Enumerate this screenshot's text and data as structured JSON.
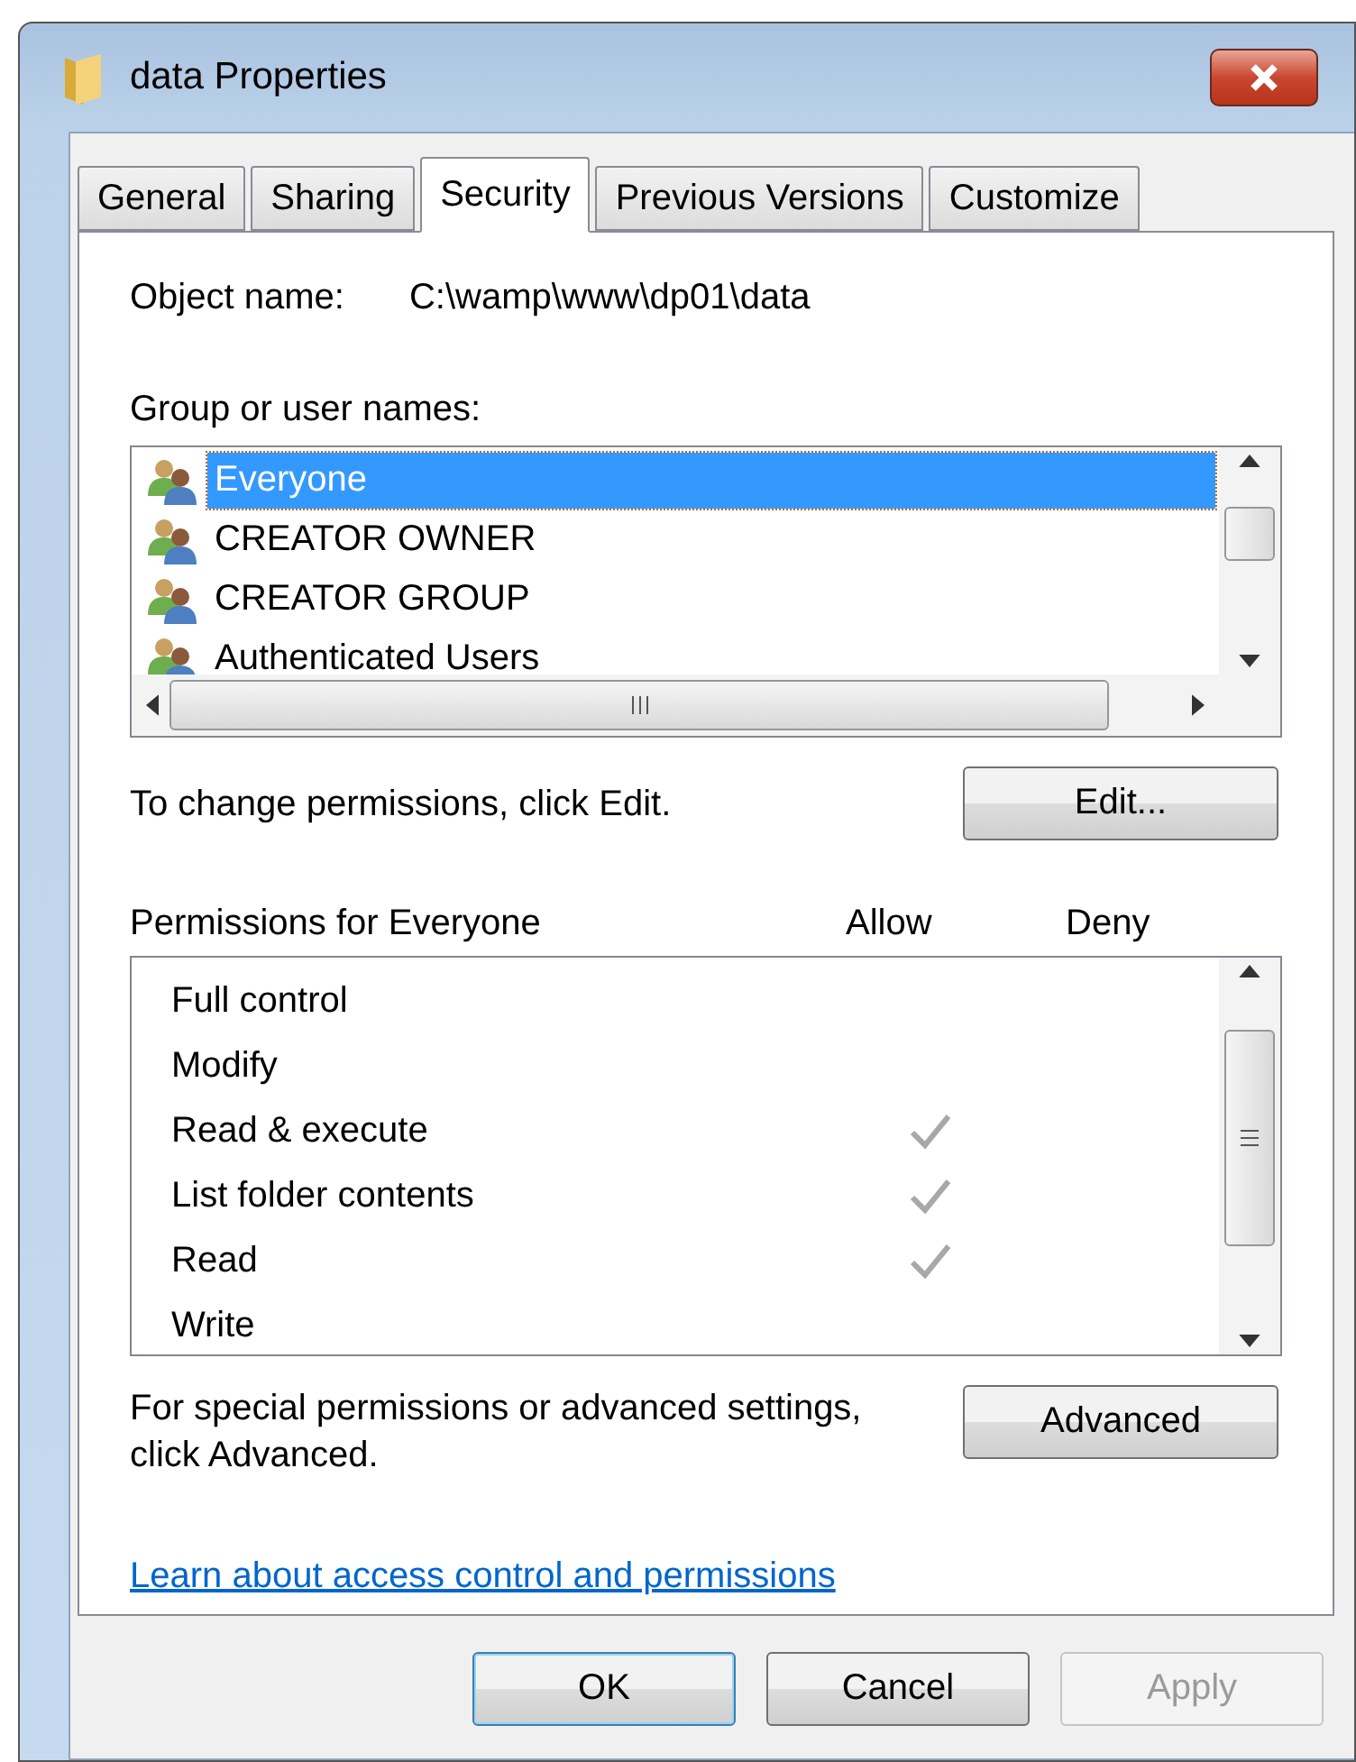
{
  "window": {
    "title": "data Properties"
  },
  "tabs": [
    {
      "label": "General",
      "selected": false
    },
    {
      "label": "Sharing",
      "selected": false
    },
    {
      "label": "Security",
      "selected": true
    },
    {
      "label": "Previous Versions",
      "selected": false
    },
    {
      "label": "Customize",
      "selected": false
    }
  ],
  "object_name": {
    "label": "Object name:",
    "value": "C:\\wamp\\www\\dp01\\data"
  },
  "groups": {
    "label": "Group or user names:",
    "items": [
      {
        "name": "Everyone",
        "selected": true
      },
      {
        "name": "CREATOR OWNER",
        "selected": false
      },
      {
        "name": "CREATOR GROUP",
        "selected": false
      },
      {
        "name": "Authenticated Users",
        "selected": false
      }
    ]
  },
  "edit_hint": "To change permissions, click Edit.",
  "edit_button": "Edit...",
  "permissions": {
    "title": "Permissions for Everyone",
    "allow_header": "Allow",
    "deny_header": "Deny",
    "rows": [
      {
        "name": "Full control",
        "allow": false,
        "deny": false
      },
      {
        "name": "Modify",
        "allow": false,
        "deny": false
      },
      {
        "name": "Read & execute",
        "allow": true,
        "deny": false
      },
      {
        "name": "List folder contents",
        "allow": true,
        "deny": false
      },
      {
        "name": "Read",
        "allow": true,
        "deny": false
      },
      {
        "name": "Write",
        "allow": false,
        "deny": false
      }
    ]
  },
  "advanced_hint": "For special permissions or advanced settings, click Advanced.",
  "advanced_button": "Advanced",
  "link": "Learn about access control and permissions",
  "buttons": [
    {
      "label": "OK",
      "default": true,
      "disabled": false
    },
    {
      "label": "Cancel",
      "default": false,
      "disabled": false
    },
    {
      "label": "Apply",
      "default": false,
      "disabled": true
    }
  ]
}
